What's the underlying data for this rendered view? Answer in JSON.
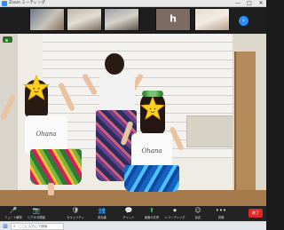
{
  "window": {
    "title": "Zoom ミーティング",
    "min_glyph": "—",
    "max_glyph": "□",
    "close_glyph": "✕"
  },
  "gallery": {
    "participants": [
      {
        "label": "",
        "initial": ""
      },
      {
        "label": "",
        "initial": ""
      },
      {
        "label": "",
        "initial": ""
      },
      {
        "label": "",
        "initial": "h"
      },
      {
        "label": "",
        "initial": ""
      }
    ],
    "next_glyph": "›"
  },
  "video": {
    "recording_label": "",
    "shirt_print": "Ohana"
  },
  "toolbar": {
    "items": [
      {
        "icon": "mic-icon",
        "glyph": "🎤",
        "label": "ミュート解除"
      },
      {
        "icon": "video-icon",
        "glyph": "📷",
        "label": "ビデオの開始"
      },
      {
        "icon": "security-icon",
        "glyph": "🛡",
        "label": "セキュリティ"
      },
      {
        "icon": "participants-icon",
        "glyph": "👥",
        "label": "参加者"
      },
      {
        "icon": "chat-icon",
        "glyph": "💬",
        "label": "チャット"
      },
      {
        "icon": "share-screen-icon",
        "glyph": "⬆",
        "label": "画面の共有"
      },
      {
        "icon": "record-icon",
        "glyph": "⏺",
        "label": "レコーディング"
      },
      {
        "icon": "reactions-icon",
        "glyph": "☺",
        "label": "反応"
      },
      {
        "icon": "more-icon",
        "glyph": "•••",
        "label": "詳細"
      }
    ],
    "end_label": "終了"
  },
  "taskbar": {
    "search_placeholder": "ここに入力して検索",
    "tray_text": ""
  },
  "colors": {
    "accent": "#2d8cff",
    "end": "#e02828",
    "star": "#ffd21f"
  }
}
